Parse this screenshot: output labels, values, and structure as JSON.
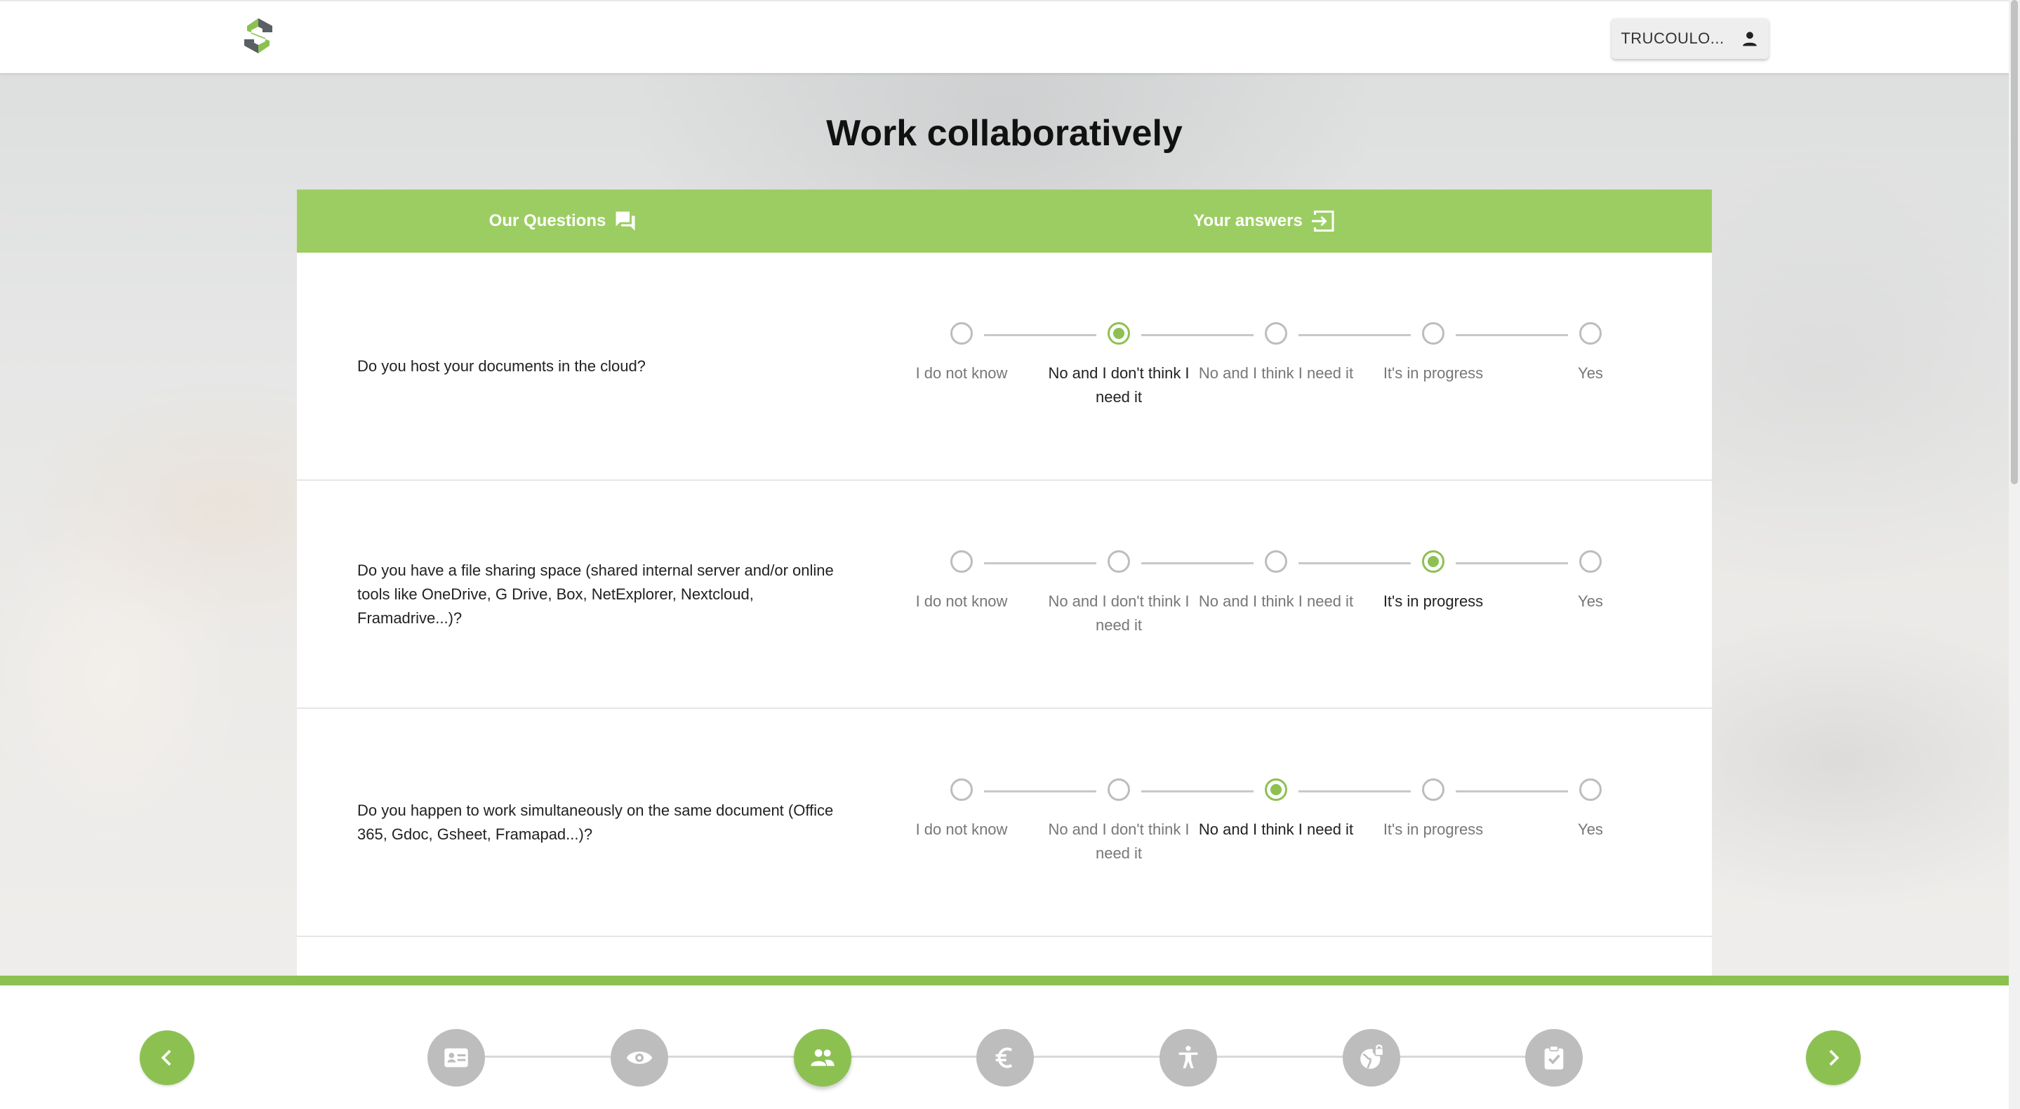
{
  "header": {
    "logo": "app-logo",
    "user_label": "TRUCOULO..."
  },
  "page": {
    "title": "Work collaboratively"
  },
  "table": {
    "col_questions": "Our Questions",
    "col_answers": "Your answers"
  },
  "scale_options": [
    "I do not know",
    "No and I don't think I need it",
    "No and I think I need it",
    "It's in progress",
    "Yes"
  ],
  "questions": [
    {
      "text": "Do you host your documents in the cloud?",
      "selected": 1,
      "options": [
        "I do not know",
        "No and I don't think I need it",
        "No and I think I need it",
        "It's in progress",
        "Yes"
      ]
    },
    {
      "text": "Do you have a file sharing space (shared internal server and/or online tools like OneDrive, G Drive, Box, NetExplorer, Nextcloud, Framadrive...)?",
      "selected": 3,
      "options": [
        "I do not know",
        "No and I don't think I need it",
        "No and I think I need it",
        "It's in progress",
        "Yes"
      ]
    },
    {
      "text": "Do you happen to work simultaneously on the same document (Office 365, Gdoc, Gsheet, Framapad...)?",
      "selected": 2,
      "options": [
        "I do not know",
        "No and I don't think I need it",
        "No and I think I need it",
        "It's in progress",
        "Yes"
      ]
    }
  ],
  "bottom_nav": {
    "steps": [
      {
        "icon": "id-card-icon",
        "active": false
      },
      {
        "icon": "eye-icon",
        "active": false
      },
      {
        "icon": "people-icon",
        "active": true
      },
      {
        "icon": "euro-icon",
        "active": false
      },
      {
        "icon": "accessibility-icon",
        "active": false
      },
      {
        "icon": "globe-lock-icon",
        "active": false
      },
      {
        "icon": "clipboard-check-icon",
        "active": false
      }
    ],
    "colors": {
      "accent": "#8cc152",
      "inactive": "#bdbdbd"
    }
  },
  "colors": {
    "header_green": "#9ccd63",
    "accent": "#8cc152"
  }
}
